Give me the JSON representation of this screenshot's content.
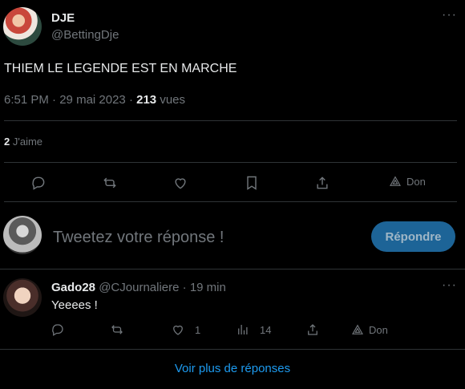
{
  "tweet": {
    "author_name": "DJE",
    "author_handle": "@BettingDje",
    "text": "THIEM LE LEGENDE EST EN MARCHE",
    "time": "6:51 PM",
    "date": "29 mai 2023",
    "views_count": "213",
    "views_label": "vues",
    "likes_count": "2",
    "likes_label": "J'aime",
    "more_label": "···",
    "actions": {
      "reply_icon": "reply-icon",
      "retweet_icon": "retweet-icon",
      "like_icon": "heart-icon",
      "bookmark_icon": "bookmark-icon",
      "share_icon": "share-icon",
      "tip_label": "Don"
    }
  },
  "composer": {
    "placeholder": "Tweetez votre réponse !",
    "reply_button": "Répondre"
  },
  "reply": {
    "name": "Gado28",
    "handle": "@CJournaliere",
    "separator": "·",
    "age": "19 min",
    "text": "Yeeees !",
    "more_label": "···",
    "likes": "1",
    "views": "14",
    "tip_label": "Don"
  },
  "footer": {
    "more_replies": "Voir plus de réponses"
  },
  "colors": {
    "background": "#000000",
    "divider": "#2f3336",
    "muted": "#71767b",
    "text": "#e7e9ea",
    "accent": "#1d9bf0",
    "reply_button_bg": "#1d6497"
  }
}
